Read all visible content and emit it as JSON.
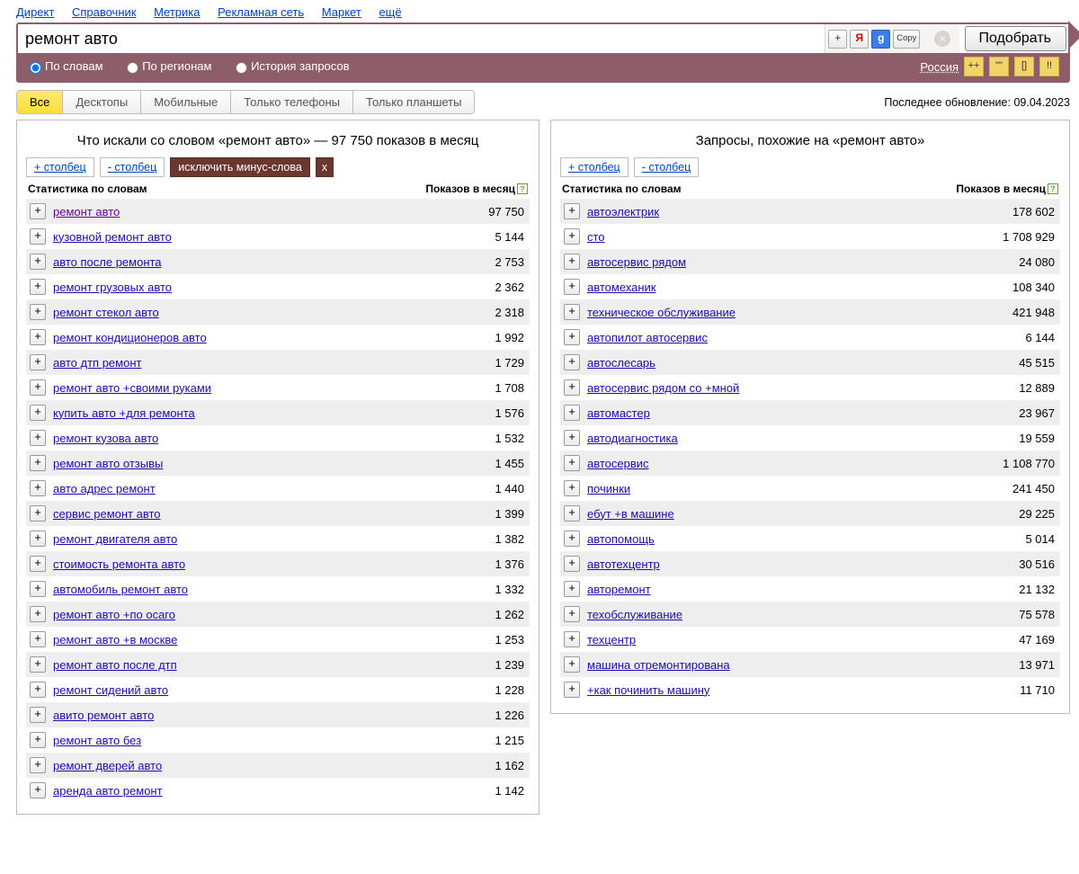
{
  "nav": {
    "links": [
      "Директ",
      "Справочник",
      "Метрика",
      "Рекламная сеть",
      "Маркет",
      "ещё"
    ]
  },
  "search": {
    "value": "ремонт авто",
    "tool_plus": "+",
    "tool_y": "Я",
    "tool_g": "g",
    "tool_copy": "Copy",
    "clear": "×",
    "submit": "Подобрать"
  },
  "filters": {
    "radios": [
      "По словам",
      "По регионам",
      "История запросов"
    ],
    "region": "Россия",
    "btns": [
      "++",
      "\"\"",
      "[]",
      "!!"
    ]
  },
  "tabs": {
    "items": [
      "Все",
      "Десктопы",
      "Мобильные",
      "Только телефоны",
      "Только планшеты"
    ],
    "update_label": "Последнее обновление: 09.04.2023"
  },
  "left": {
    "title": "Что искали со словом «ремонт авто» — 97 750 показов в месяц",
    "add_col": "+ столбец",
    "del_col": "- столбец",
    "exclude": "исключить минус-слова",
    "x": "x",
    "head_left": "Статистика по словам",
    "head_right": "Показов в месяц",
    "rows": [
      {
        "k": "ремонт авто",
        "v": "97 750",
        "vis": true
      },
      {
        "k": "кузовной ремонт авто",
        "v": "5 144"
      },
      {
        "k": "авто после ремонта",
        "v": "2 753"
      },
      {
        "k": "ремонт грузовых авто",
        "v": "2 362"
      },
      {
        "k": "ремонт стекол авто",
        "v": "2 318"
      },
      {
        "k": "ремонт кондиционеров авто",
        "v": "1 992"
      },
      {
        "k": "авто дтп ремонт",
        "v": "1 729"
      },
      {
        "k": "ремонт авто +своими руками",
        "v": "1 708"
      },
      {
        "k": "купить авто +для ремонта",
        "v": "1 576"
      },
      {
        "k": "ремонт кузова авто",
        "v": "1 532"
      },
      {
        "k": "ремонт авто отзывы",
        "v": "1 455"
      },
      {
        "k": "авто адрес ремонт",
        "v": "1 440"
      },
      {
        "k": "сервис ремонт авто",
        "v": "1 399"
      },
      {
        "k": "ремонт двигателя авто",
        "v": "1 382"
      },
      {
        "k": "стоимость ремонта авто",
        "v": "1 376"
      },
      {
        "k": "автомобиль ремонт авто",
        "v": "1 332"
      },
      {
        "k": "ремонт авто +по осаго",
        "v": "1 262"
      },
      {
        "k": "ремонт авто +в москве",
        "v": "1 253"
      },
      {
        "k": "ремонт авто после дтп",
        "v": "1 239"
      },
      {
        "k": "ремонт сидений авто",
        "v": "1 228"
      },
      {
        "k": "авито ремонт авто",
        "v": "1 226"
      },
      {
        "k": "ремонт авто без",
        "v": "1 215"
      },
      {
        "k": "ремонт дверей авто",
        "v": "1 162"
      },
      {
        "k": "аренда авто ремонт",
        "v": "1 142"
      }
    ]
  },
  "right": {
    "title": "Запросы, похожие на «ремонт авто»",
    "add_col": "+ столбец",
    "del_col": "- столбец",
    "head_left": "Статистика по словам",
    "head_right": "Показов в месяц",
    "rows": [
      {
        "k": "автоэлектрик",
        "v": "178 602"
      },
      {
        "k": "сто",
        "v": "1 708 929"
      },
      {
        "k": "автосервис рядом",
        "v": "24 080"
      },
      {
        "k": "автомеханик",
        "v": "108 340"
      },
      {
        "k": "техническое обслуживание",
        "v": "421 948"
      },
      {
        "k": "автопилот автосервис",
        "v": "6 144"
      },
      {
        "k": "автослесарь",
        "v": "45 515"
      },
      {
        "k": "автосервис рядом со +мной",
        "v": "12 889"
      },
      {
        "k": "автомастер",
        "v": "23 967"
      },
      {
        "k": "автодиагностика",
        "v": "19 559"
      },
      {
        "k": "автосервис",
        "v": "1 108 770"
      },
      {
        "k": "починки",
        "v": "241 450"
      },
      {
        "k": "ебут +в машине",
        "v": "29 225"
      },
      {
        "k": "автопомощь",
        "v": "5 014"
      },
      {
        "k": "автотехцентр",
        "v": "30 516"
      },
      {
        "k": "авторемонт",
        "v": "21 132"
      },
      {
        "k": "техобслуживание",
        "v": "75 578"
      },
      {
        "k": "техцентр",
        "v": "47 169"
      },
      {
        "k": "машина отремонтирована",
        "v": "13 971"
      },
      {
        "k": "+как починить машину",
        "v": "11 710"
      }
    ]
  }
}
